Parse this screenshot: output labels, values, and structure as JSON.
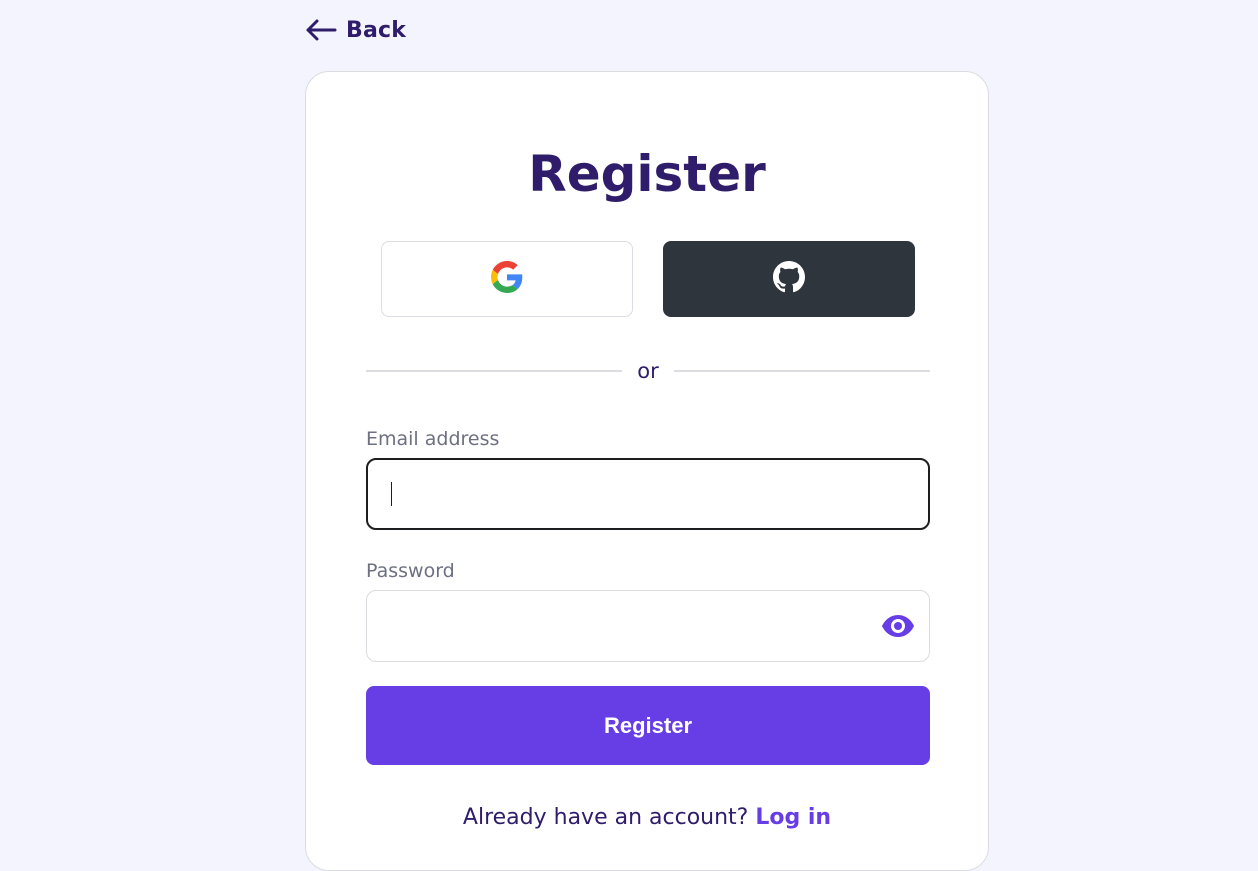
{
  "nav": {
    "back_label": "Back"
  },
  "form": {
    "title": "Register",
    "social": {
      "google_icon": "google-icon",
      "github_icon": "github-icon"
    },
    "divider_text": "or",
    "email": {
      "label": "Email address",
      "value": "",
      "placeholder": ""
    },
    "password": {
      "label": "Password",
      "value": "",
      "placeholder": "",
      "toggle_icon": "eye-icon"
    },
    "submit_label": "Register",
    "login_prompt": "Already have an account?",
    "login_link": "Log in"
  },
  "colors": {
    "background": "#f4f4ff",
    "primary": "#673de6",
    "heading": "#2f1c6a",
    "github": "#2f353d"
  }
}
